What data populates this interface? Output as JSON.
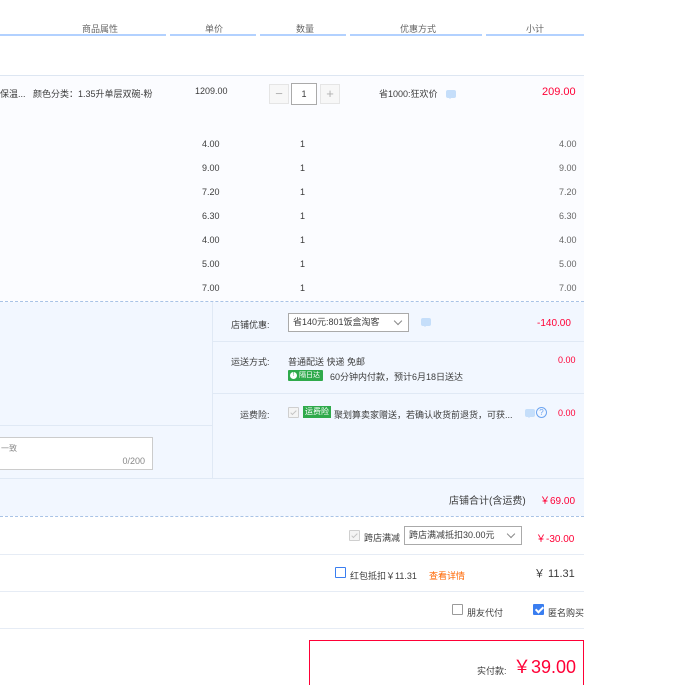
{
  "header": {
    "col_attrs": "商品属性",
    "col_price": "单价",
    "col_qty": "数量",
    "col_discount": "优惠方式",
    "col_subtotal": "小计"
  },
  "main_item": {
    "name_snippet": "保温...",
    "attrs": "颜色分类：1.35升单层双碗-粉",
    "price": "1209.00",
    "qty": "1",
    "minus": "−",
    "plus": "+",
    "discount": "省1000:狂欢价",
    "subtotal": "209.00"
  },
  "sub_items": [
    {
      "price": "4.00",
      "qty": "1",
      "subtotal": "4.00"
    },
    {
      "price": "9.00",
      "qty": "1",
      "subtotal": "9.00"
    },
    {
      "price": "7.20",
      "qty": "1",
      "subtotal": "7.20"
    },
    {
      "price": "6.30",
      "qty": "1",
      "subtotal": "6.30"
    },
    {
      "price": "4.00",
      "qty": "1",
      "subtotal": "4.00"
    },
    {
      "price": "5.00",
      "qty": "1",
      "subtotal": "5.00"
    },
    {
      "price": "7.00",
      "qty": "1",
      "subtotal": "7.00"
    }
  ],
  "shop": {
    "promo_label": "店铺优惠:",
    "promo_select": "省140元:801饭盒淘客",
    "promo_amount": "-140.00",
    "shipping_label": "运送方式:",
    "shipping_text": "普通配送 快递 免邮",
    "shipping_badge": "隔日达",
    "shipping_eta": "60分钟内付款，预计6月18日送达",
    "shipping_amount": "0.00",
    "insurance_label": "运费险:",
    "insurance_tag": "运费险",
    "insurance_text": "聚划算卖家赠送，若确认收货前退货，可获...",
    "insurance_amount": "0.00",
    "message_placeholder": "一致",
    "message_counter": "0/200",
    "total_label": "店铺合计(含运费)",
    "total_amount": "￥69.00"
  },
  "cross_store": {
    "label": "跨店满减",
    "select": "跨店满减抵扣30.00元",
    "amount": "￥-30.00"
  },
  "red_packet": {
    "label": "红包抵扣￥11.31",
    "link": "查看详情",
    "amount": "￥ 11.31"
  },
  "options": {
    "friend_pay": "朋友代付",
    "anonymous": "匿名购买"
  },
  "pay": {
    "label": "实付款:",
    "amount": "￥39.00"
  },
  "colors": {
    "accent_red": "#ff0036",
    "link_orange": "#ff6600",
    "header_line": "#b2d1ff",
    "badge_green": "#2faa4b"
  }
}
